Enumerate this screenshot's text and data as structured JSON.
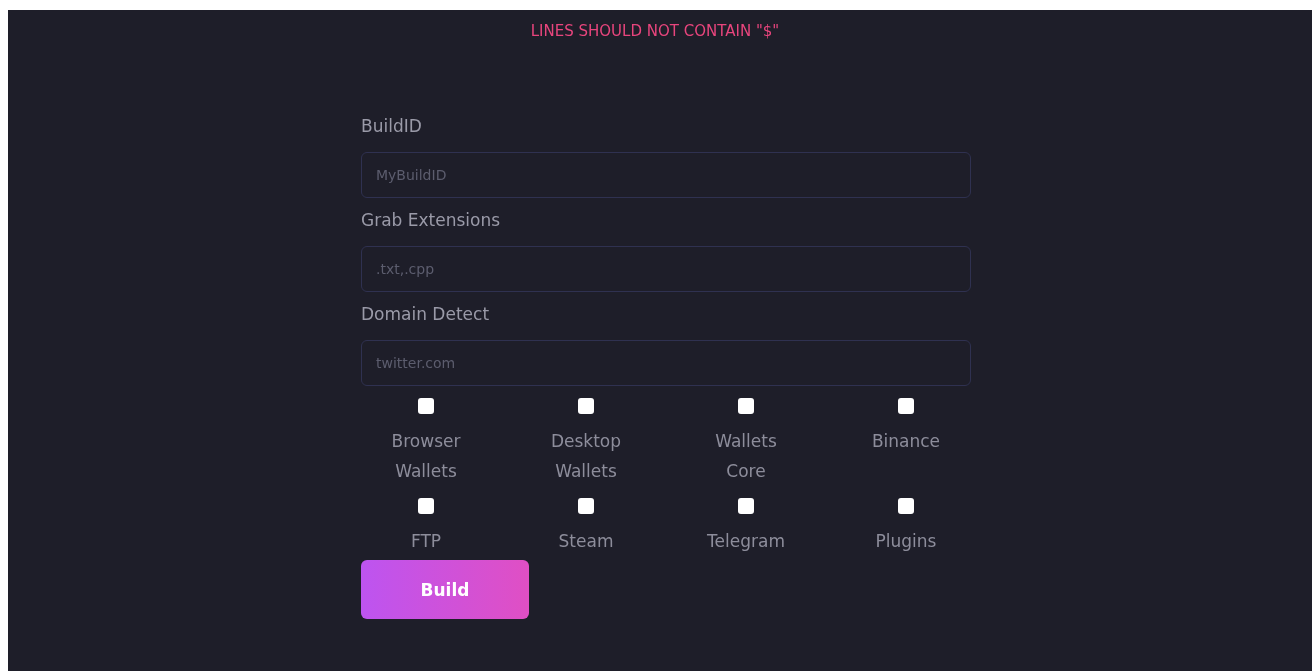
{
  "warning": "LINES SHOULD NOT CONTAIN \"$\"",
  "fields": [
    {
      "label": "BuildID",
      "placeholder": "MyBuildID"
    },
    {
      "label": "Grab Extensions",
      "placeholder": ".txt,.cpp"
    },
    {
      "label": "Domain Detect",
      "placeholder": "twitter.com"
    }
  ],
  "options": [
    {
      "label": "Browser Wallets",
      "checked": false
    },
    {
      "label": "Desktop Wallets",
      "checked": false
    },
    {
      "label": "Wallets Core",
      "checked": false
    },
    {
      "label": "Binance",
      "checked": false
    },
    {
      "label": "FTP",
      "checked": false
    },
    {
      "label": "Steam",
      "checked": false
    },
    {
      "label": "Telegram",
      "checked": false
    },
    {
      "label": "Plugins",
      "checked": false
    }
  ],
  "button": "Build"
}
